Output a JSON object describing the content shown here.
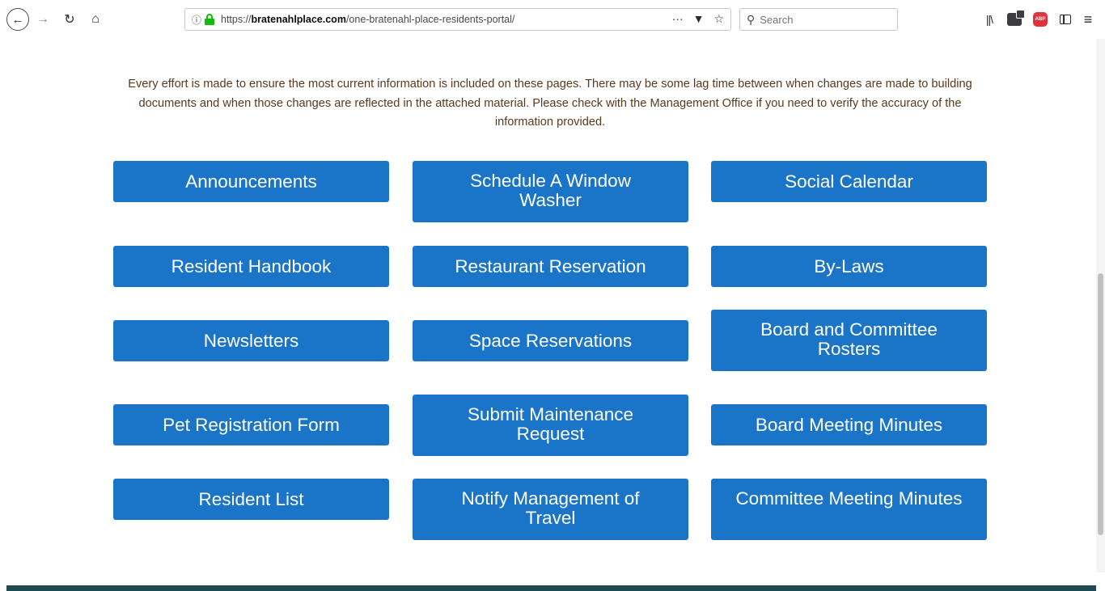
{
  "browser": {
    "url_scheme": "https://",
    "url_domain": "bratenahlplace.com",
    "url_path": "/one-bratenahl-place-residents-portal/",
    "search_placeholder": "Search",
    "icons": {
      "back": "back-arrow-icon",
      "forward": "forward-arrow-icon",
      "reload": "reload-icon",
      "home": "home-icon",
      "info": "info-icon",
      "lock": "lock-icon",
      "page_actions": "more-dots-icon",
      "pocket": "pocket-icon",
      "bookmark": "star-icon",
      "library": "library-icon",
      "extension": "extension-icon",
      "adblock": "adblock-icon",
      "sidebar": "sidebar-icon",
      "menu": "hamburger-menu-icon"
    },
    "adblock_label": "ABP"
  },
  "notice_text": "Every effort is made to ensure the most current information is included on these pages. There may be some lag time between when changes are made to building documents and when those changes are reflected in the attached material. Please check with the Management Office if you need to verify the accuracy of the information provided.",
  "buttons": {
    "announcements": "Announcements",
    "window_washer": "Schedule A Window Washer",
    "social_calendar": "Social Calendar",
    "resident_handbook": "Resident Handbook",
    "restaurant_reservation": "Restaurant Reservation",
    "by_laws": "By-Laws",
    "newsletters": "Newsletters",
    "space_reservations": "Space Reservations",
    "board_rosters": "Board and Committee Rosters",
    "pet_registration": "Pet Registration Form",
    "maintenance_request": "Submit Maintenance Request",
    "board_minutes": "Board Meeting Minutes",
    "resident_list": "Resident List",
    "notify_travel": "Notify Management of Travel",
    "committee_minutes": "Committee Meeting Minutes"
  },
  "colors": {
    "button_bg": "#1a75c9",
    "notice_text": "#5a3a1e",
    "footer": "#1f4a52",
    "lock_green": "#12bc00"
  }
}
